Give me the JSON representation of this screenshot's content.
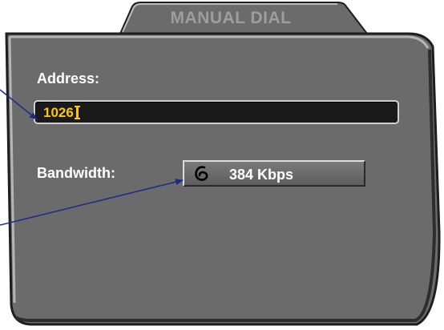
{
  "dialog": {
    "title": "MANUAL DIAL"
  },
  "address": {
    "label": "Address:",
    "value": "1026"
  },
  "bandwidth": {
    "label": "Bandwidth:",
    "value": "384 Kbps",
    "icon": "cycle-icon"
  },
  "colors": {
    "panel": "#6b6b6b",
    "panel_highlight": "#b5b5b5",
    "panel_shadow": "#1e1e1e",
    "address_text": "#ffc800",
    "callout_line": "#1c2a8c"
  }
}
